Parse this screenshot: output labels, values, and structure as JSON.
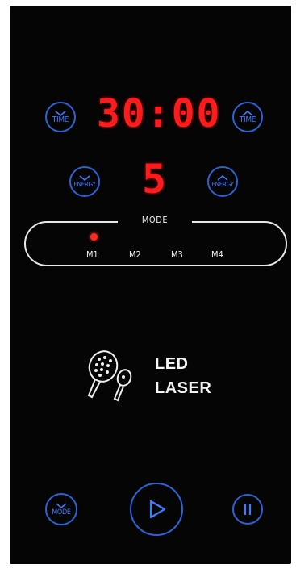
{
  "display": {
    "time": "30:00",
    "energy": "5"
  },
  "buttons": {
    "time_down": "TIME",
    "time_up": "TIME",
    "energy_down": "ENERGY",
    "energy_up": "ENERGY",
    "mode": "MODE"
  },
  "mode_panel": {
    "title": "MODE",
    "modes": [
      "M1",
      "M2",
      "M3",
      "M4"
    ],
    "active_mode": "M1"
  },
  "brand": {
    "line1": "LED",
    "line2": "LASER"
  },
  "icons": {
    "play": "play-icon",
    "pause": "pause-icon",
    "device": "led-laser-device-icon"
  },
  "colors": {
    "panel": "#050505",
    "display": "#ff1b1b",
    "button": "#2a63d6",
    "text": "#f0f0f0"
  }
}
